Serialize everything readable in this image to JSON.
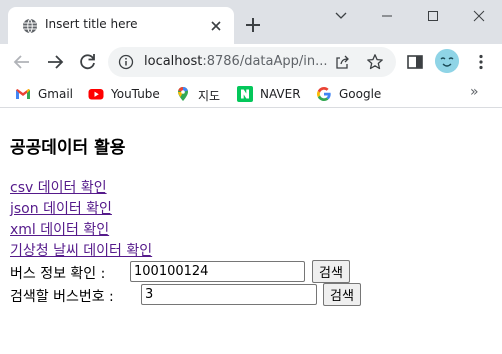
{
  "tab": {
    "title": "Insert title here"
  },
  "toolbar": {
    "url_host": "localhost",
    "url_path": ":8786/dataApp/in..."
  },
  "bookmarks": [
    {
      "label": "Gmail",
      "icon": "gmail-icon"
    },
    {
      "label": "YouTube",
      "icon": "youtube-icon"
    },
    {
      "label": "지도",
      "icon": "maps-icon"
    },
    {
      "label": "NAVER",
      "icon": "naver-icon"
    },
    {
      "label": "Google",
      "icon": "google-icon"
    }
  ],
  "bookmarks_more": "»",
  "page": {
    "title": "공공데이터 활용",
    "links": [
      "csv 데이터 확인",
      "json 데이터 확인",
      "xml 데이터 확인",
      "기상청 날씨 데이터 확인"
    ],
    "bus_info": {
      "label": "버스 정보 확인 :",
      "value": "100100124",
      "button": "검색"
    },
    "bus_number": {
      "label": "검색할 버스번호 :",
      "value": "3",
      "button": "검색"
    }
  },
  "colors": {
    "tabstrip_bg": "#dee1e6",
    "link_visited": "#551a8b",
    "omnibox_bg": "#f1f3f4"
  }
}
